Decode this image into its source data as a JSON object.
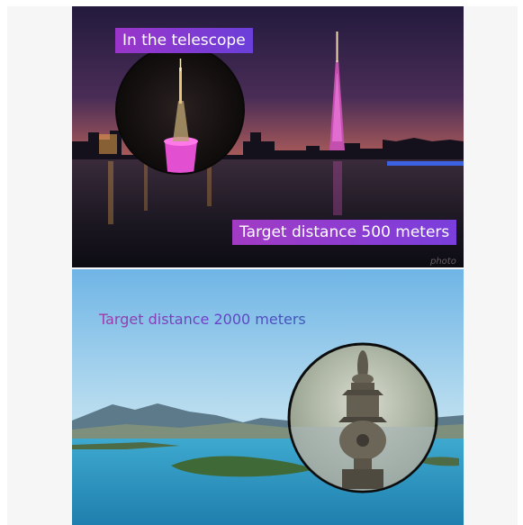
{
  "top_panel": {
    "caption_top": "In the telescope",
    "caption_bottom": "Target distance 500 meters",
    "watermark": "photo"
  },
  "bottom_panel": {
    "caption": "Target distance 2000 meters"
  },
  "colors": {
    "caption_box_start": "#9b35c9",
    "caption_box_end": "#6a3fd9",
    "tower_pink": "#e24fd0",
    "sky_dusk_top": "#24183f",
    "sky_dusk_horizon": "#f0a055",
    "lake_blue": "#3aa0c8"
  }
}
